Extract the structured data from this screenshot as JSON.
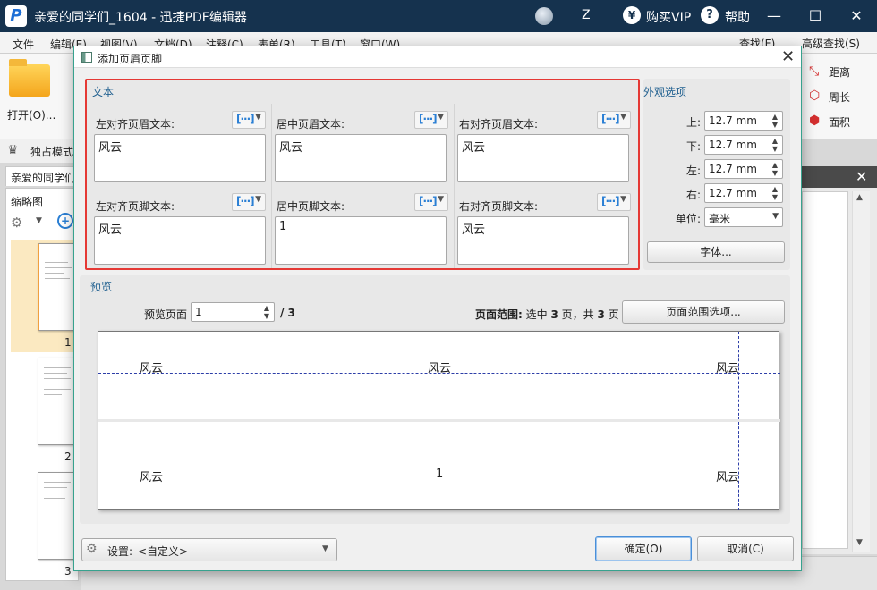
{
  "app": {
    "title": "亲爱的同学们_1604 - 迅捷PDF编辑器",
    "user": "Z",
    "vip_label": "购买VIP",
    "help_label": "帮助",
    "window_buttons": {
      "minimize": "—",
      "maximize": "☐",
      "close": "✕"
    }
  },
  "menu": {
    "items": [
      "文件",
      "编辑(E)",
      "视图(V)",
      "文档(D)",
      "注释(C)",
      "表单(R)",
      "工具(T)",
      "窗口(W)"
    ]
  },
  "ribbon": {
    "open_label": "打开(O)...",
    "search_label": "查找(F)",
    "advanced_search_label": "高级查找(S)",
    "measure": [
      "距离",
      "周长",
      "面积"
    ]
  },
  "mode_label": "独占模式",
  "doc_tab_label": "亲爱的同学们",
  "thumbnails": {
    "title": "缩略图",
    "pages": [
      "1",
      "2",
      "3"
    ]
  },
  "dialog": {
    "title": "添加页眉页脚",
    "text_section": {
      "title": "文本",
      "fields": [
        {
          "label": "左对齐页眉文本:",
          "value": "风云"
        },
        {
          "label": "居中页眉文本:",
          "value": "风云"
        },
        {
          "label": "右对齐页眉文本:",
          "value": "风云"
        },
        {
          "label": "左对齐页脚文本:",
          "value": "风云"
        },
        {
          "label": "居中页脚文本:",
          "value": "1"
        },
        {
          "label": "右对齐页脚文本:",
          "value": "风云"
        }
      ],
      "insert_icon": "[···]"
    },
    "appearance": {
      "title": "外观选项",
      "top_label": "上:",
      "top_value": "12.7 mm",
      "bottom_label": "下:",
      "bottom_value": "12.7 mm",
      "left_label": "左:",
      "left_value": "12.7 mm",
      "right_label": "右:",
      "right_value": "12.7 mm",
      "unit_label": "单位:",
      "unit_value": "毫米",
      "font_button": "字体..."
    },
    "preview": {
      "title": "预览",
      "page_label": "预览页面",
      "page_value": "1",
      "page_total": "/ 3",
      "range_label": "页面范围:",
      "range_text_1": "选中",
      "range_selected": "3",
      "range_text_2": "页，共",
      "range_total": "3",
      "range_text_3": "页",
      "range_button": "页面范围选项...",
      "header_left": "风云",
      "header_center": "风云",
      "header_right": "风云",
      "footer_left": "风云",
      "footer_center": "1",
      "footer_right": "风云"
    },
    "settings_label": "设置:",
    "settings_value": "<自定义>",
    "ok_button": "确定(O)",
    "cancel_button": "取消(C)"
  },
  "colors": {
    "titlebar": "#15324e",
    "highlight_border": "#e53935",
    "dialog_border": "#37a28e",
    "guide_line": "#2d3ea8",
    "section_title": "#1f5f8f"
  }
}
